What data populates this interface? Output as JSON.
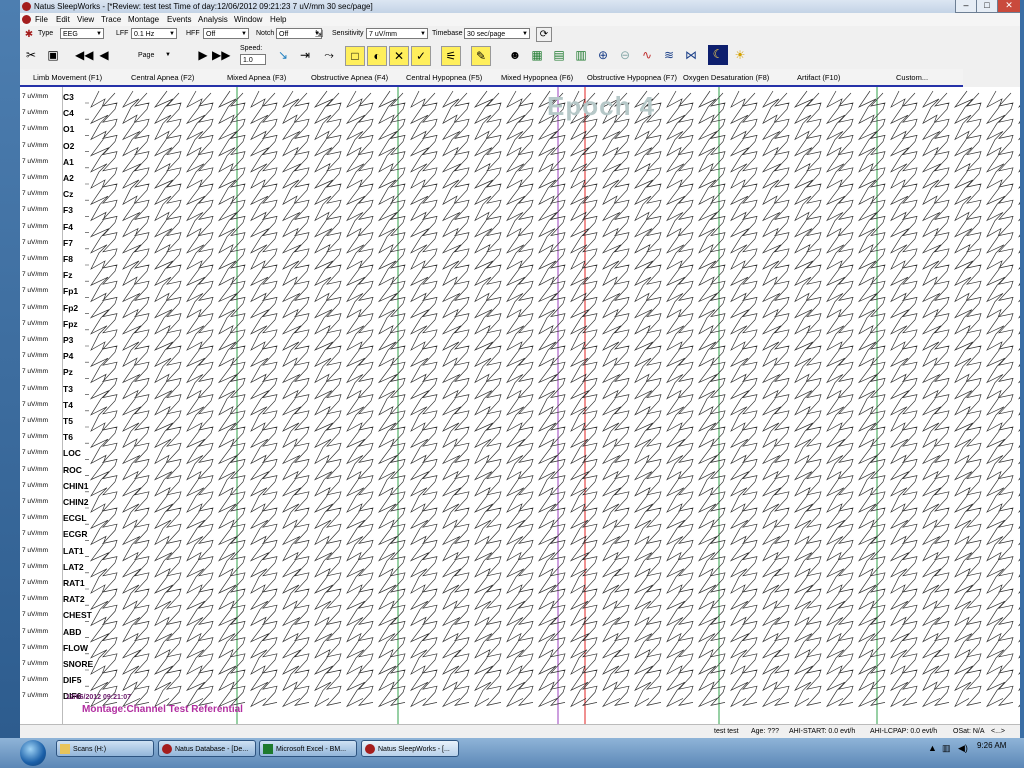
{
  "window": {
    "title": "Natus SleepWorks - [*Review:  test test  Time of day:12/06/2012 09:21:23   7 uV/mm  30 sec/page]",
    "minimize": "–",
    "maximize": "□",
    "close": "✕",
    "mdi_minimize": "–",
    "mdi_restore": "❐",
    "mdi_close": "✕"
  },
  "menu": [
    "File",
    "Edit",
    "View",
    "Trace",
    "Montage",
    "Events",
    "Analysis",
    "Window",
    "Help"
  ],
  "toolbar": {
    "type_label": "Type",
    "type_value": "EEG",
    "lff_label": "LFF",
    "lff_value": "0.1 Hz",
    "hff_label": "HFF",
    "hff_value": "Off",
    "notch_label": "Notch",
    "notch_value": "Off",
    "sensitivity_label": "Sensitivity",
    "sensitivity_value": "7 uV/mm",
    "timebase_label": "Timebase",
    "timebase_value": "30 sec/page",
    "page_value": "Page",
    "speed_label": "Speed:",
    "speed_value": "1.0"
  },
  "event_buttons": [
    "Limb Movement (F1)",
    "Central Apnea (F2)",
    "Mixed Apnea (F3)",
    "Obstructive Apnea (F4)",
    "Central Hypopnea (F5)",
    "Mixed Hypopnea (F6)",
    "Obstructive Hypopnea (F7)",
    "Oxygen Desaturation (F8)",
    "Artifact (F10)",
    "Custom..."
  ],
  "channels": [
    "C3",
    "C4",
    "O1",
    "O2",
    "A1",
    "A2",
    "Cz",
    "F3",
    "F4",
    "F7",
    "F8",
    "Fz",
    "Fp1",
    "Fp2",
    "Fpz",
    "P3",
    "P4",
    "Pz",
    "T3",
    "T4",
    "T5",
    "T6",
    "LOC",
    "ROC",
    "CHIN1",
    "CHIN2",
    "ECGL",
    "ECGR",
    "LAT1",
    "LAT2",
    "RAT1",
    "RAT2",
    "CHEST",
    "ABD",
    "FLOW",
    "SNORE",
    "DIF5",
    "DIF6"
  ],
  "sensitivity_per_channel": "7 uV/mm",
  "overlay": {
    "epoch_label": "Epoch 4",
    "timestamp": "12/06/2012 09:21:07",
    "montage": "Montage:Channel Test Referential"
  },
  "status": {
    "patient": "test test",
    "age": "Age: ???",
    "ahi_start": "AHI-START: 0.0 evt/h",
    "ahi_lcpap": "AHI-LCPAP: 0.0 evt/h",
    "osat": "OSat: N/A",
    "nav": "<...>"
  },
  "taskbar": {
    "items": [
      "Scans  (H:)",
      "Natus Database - [De...",
      "Microsoft Excel - BM...",
      "Natus SleepWorks - [..."
    ],
    "clock": "9:26 AM"
  },
  "colors": {
    "event_underline": "#2632a8",
    "red_cursor": "#e02020",
    "purple_marker": "#9b3fbf",
    "green_marker": "#2fa24a",
    "montage_text": "#b12ea0"
  }
}
